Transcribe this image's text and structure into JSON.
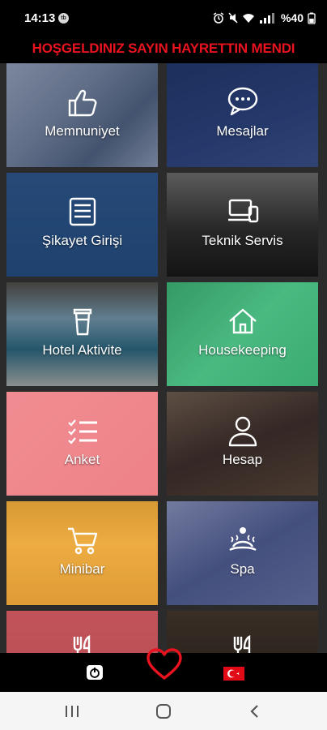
{
  "status": {
    "time": "14:13",
    "notif_badge": "tb",
    "battery": "%40"
  },
  "header": {
    "welcome": "HOŞGELDINIZ SAYIN HAYRETTIN MENDI"
  },
  "tiles": [
    {
      "label": "Memnuniyet",
      "icon": "thumbs-up-icon",
      "overlay": "#3a4a66"
    },
    {
      "label": "Mesajlar",
      "icon": "chat-bubble-icon",
      "overlay": "#263a6b"
    },
    {
      "label": "Şikayet Girişi",
      "icon": "complaint-list-icon",
      "overlay": "#25456e"
    },
    {
      "label": "Teknik Servis",
      "icon": "devices-icon",
      "overlay": "#2a2a2a"
    },
    {
      "label": "Hotel Aktivite",
      "icon": "coffee-cup-icon",
      "overlay": "#1f3a4a"
    },
    {
      "label": "Housekeeping",
      "icon": "house-icon",
      "overlay": "#3aa973"
    },
    {
      "label": "Anket",
      "icon": "checklist-icon",
      "overlay": "#ee7f84"
    },
    {
      "label": "Hesap",
      "icon": "user-icon",
      "overlay": "#3b2e2a"
    },
    {
      "label": "Minibar",
      "icon": "cart-icon",
      "overlay": "#e9a83a"
    },
    {
      "label": "Spa",
      "icon": "spa-icon",
      "overlay": "#45517a"
    },
    {
      "label": "",
      "icon": "restaurant-icon",
      "overlay": "#e07078"
    },
    {
      "label": "",
      "icon": "restaurant-icon",
      "overlay": "#2a2420"
    }
  ],
  "colors": {
    "accent_red": "#e8131f",
    "background": "#000000"
  },
  "bottom_nav": {
    "icons": [
      "power-icon",
      "heart-icon",
      "turkey-flag-icon"
    ]
  },
  "system_nav": {
    "icons": [
      "recent-apps-icon",
      "home-icon",
      "back-icon"
    ]
  }
}
